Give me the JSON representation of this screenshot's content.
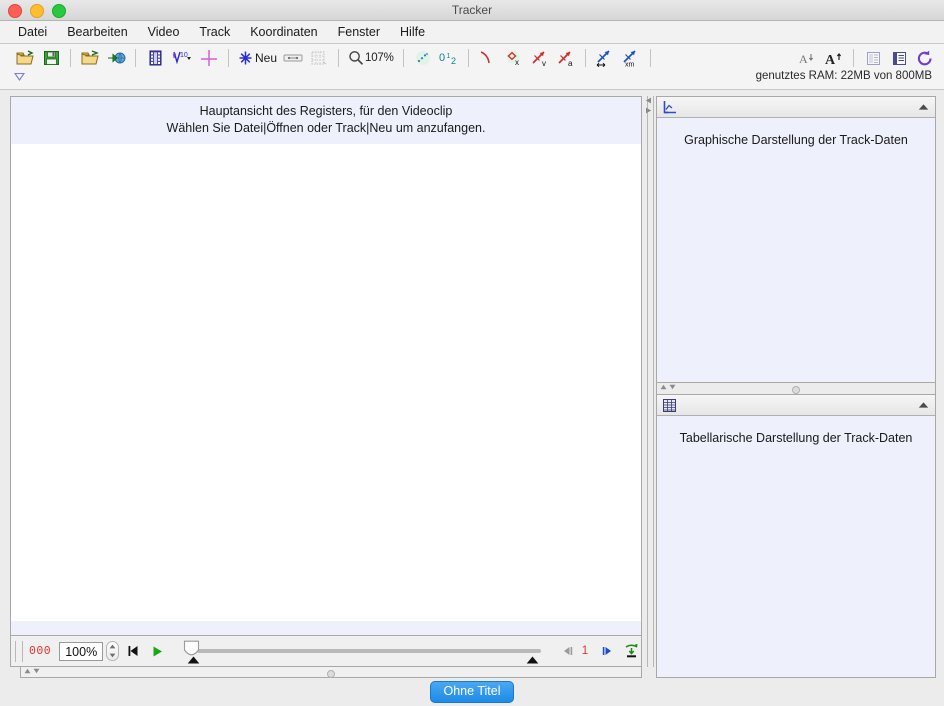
{
  "window": {
    "title": "Tracker",
    "traffic_lights": [
      "close",
      "minimize",
      "maximize"
    ]
  },
  "menubar": {
    "items": [
      {
        "label": "Datei"
      },
      {
        "label": "Bearbeiten"
      },
      {
        "label": "Video"
      },
      {
        "label": "Track"
      },
      {
        "label": "Koordinaten"
      },
      {
        "label": "Fenster"
      },
      {
        "label": "Hilfe"
      }
    ]
  },
  "toolbar": {
    "open_label": "",
    "zoom_value": "107%",
    "new_track_label": "Neu",
    "ram_status": "genutztes RAM: 22MB von 800MB",
    "icons": [
      {
        "name": "open-folder-icon"
      },
      {
        "name": "save-icon"
      },
      {
        "name": "open-video-icon"
      },
      {
        "name": "import-web-icon"
      },
      {
        "name": "film-clip-icon"
      },
      {
        "name": "video-filter-icon"
      },
      {
        "name": "axes-icon"
      },
      {
        "name": "new-track-icon"
      },
      {
        "name": "calibration-tape-icon"
      },
      {
        "name": "calibration-grid-icon"
      },
      {
        "name": "magnifier-icon"
      },
      {
        "name": "trails-icon"
      },
      {
        "name": "frame-numbers-icon"
      },
      {
        "name": "path-curve-icon"
      },
      {
        "name": "position-x-icon"
      },
      {
        "name": "velocity-v-icon"
      },
      {
        "name": "acceleration-a-icon"
      },
      {
        "name": "vector-xy-icon"
      },
      {
        "name": "vector-xm-icon"
      },
      {
        "name": "font-smaller-icon"
      },
      {
        "name": "font-larger-icon"
      },
      {
        "name": "data-table-layout-icon"
      },
      {
        "name": "panel-layout-icon"
      },
      {
        "name": "refresh-icon"
      }
    ]
  },
  "video_panel": {
    "message_line1": "Hauptansicht des Registers, für den Videoclip",
    "message_line2": "Wählen Sie Datei|Öffnen oder Track|Neu um anzufangen."
  },
  "player": {
    "frame_number": "000",
    "rate_value": "100%",
    "rate_placeholder": "100%",
    "step_value": "1",
    "buttons": [
      {
        "name": "rewind-button"
      },
      {
        "name": "play-button"
      },
      {
        "name": "step-back-button"
      },
      {
        "name": "step-forward-button"
      },
      {
        "name": "loop-export-button"
      }
    ],
    "slider": {
      "position_percent": 0,
      "in_marker_percent": 2,
      "out_marker_percent": 98
    }
  },
  "plot_panel": {
    "title_icon": "plot-axes-icon",
    "message": "Graphische Darstellung der Track-Daten",
    "collapse_icon": "collapse-up-icon"
  },
  "table_panel": {
    "title_icon": "data-table-icon",
    "message": "Tabellarische Darstellung der Track-Daten",
    "collapse_icon": "collapse-up-icon"
  },
  "statusbar": {
    "tab_label": "Ohne Titel"
  },
  "colors": {
    "accent_blue": "#1d8ae8",
    "panel_bg": "#eef0fb",
    "frame_red": "#e03030",
    "play_green": "#17a81a",
    "window_bg": "#ececec"
  }
}
